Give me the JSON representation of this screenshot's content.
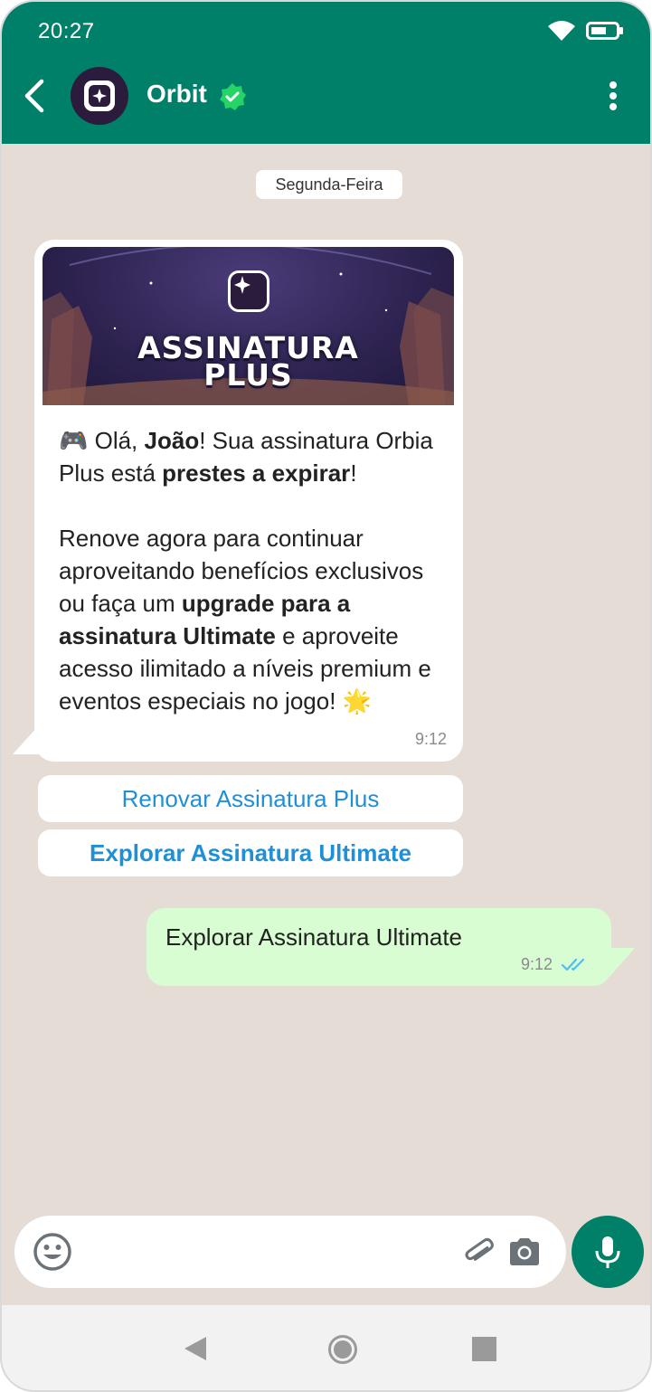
{
  "status_bar": {
    "time": "20:27"
  },
  "header": {
    "contact_name": "Orbit"
  },
  "chat": {
    "date_label": "Segunda-Feira",
    "incoming": {
      "banner_line1": "ASSINATURA",
      "banner_line2": "PLUS",
      "text": {
        "p1_emoji": "🎮",
        "p1_a": " Olá, ",
        "p1_name": "João",
        "p1_b": "! Sua assinatura Orbia Plus está ",
        "p1_bold": "prestes a expirar",
        "p1_c": "!",
        "p2_a": "Renove agora para continuar aproveitando benefícios exclusivos ou faça um ",
        "p2_bold": "upgrade para a assinatura Ultimate",
        "p2_b": " e aproveite acesso ilimitado a níveis premium e eventos especiais no jogo! ",
        "p2_emoji": "🌟"
      },
      "time": "9:12"
    },
    "quick_replies": [
      "Renovar Assinatura Plus",
      "Explorar Assinatura Ultimate"
    ],
    "outgoing": {
      "text": "Explorar Assinatura Ultimate",
      "time": "9:12"
    }
  },
  "colors": {
    "header": "#008069",
    "chat_background": "#e5ddd5",
    "outgoing_bubble": "#d9fdd3",
    "link": "#1f8fd6",
    "read_check": "#53bdeb",
    "verified": "#25d366"
  },
  "icons": [
    "wifi-icon",
    "battery-icon",
    "back-arrow-icon",
    "verified-icon",
    "more-vert-icon",
    "emoji-icon",
    "paperclip-icon",
    "camera-icon",
    "mic-icon",
    "double-check-icon"
  ]
}
